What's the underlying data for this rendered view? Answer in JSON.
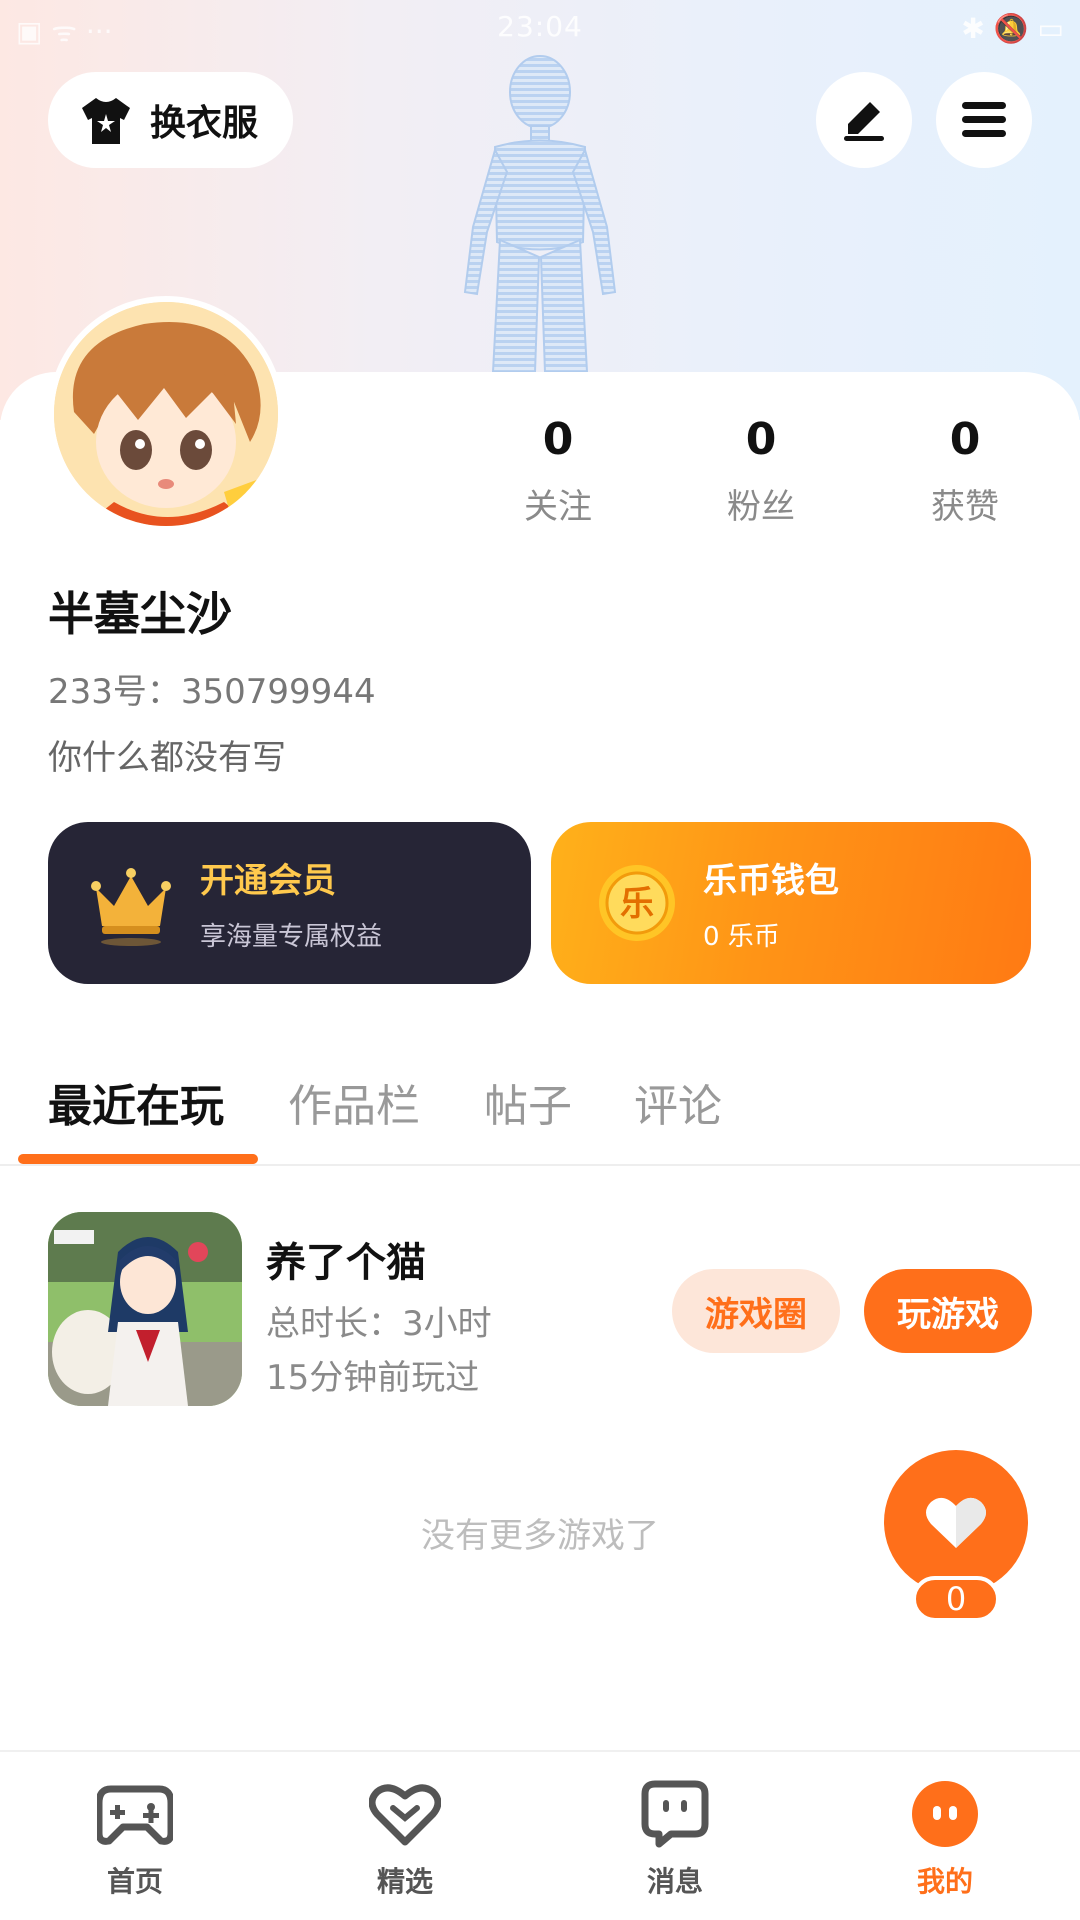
{
  "status_bar": {
    "time": "23:04",
    "left_icons": "▣  ᯤ  ···",
    "right_icons": "✱  🔕  ▭"
  },
  "header": {
    "change_clothes_label": "换衣服"
  },
  "profile": {
    "username": "半墓尘沙",
    "uid_label": "233号：350799944",
    "bio": "你什么都没有写",
    "stats": [
      {
        "value": "0",
        "label": "关注"
      },
      {
        "value": "0",
        "label": "粉丝"
      },
      {
        "value": "0",
        "label": "获赞"
      }
    ]
  },
  "promos": {
    "vip": {
      "title": "开通会员",
      "subtitle": "享海量专属权益"
    },
    "wallet": {
      "title": "乐币钱包",
      "subtitle": "0 乐币",
      "coin_char": "乐"
    }
  },
  "tabs": [
    "最近在玩",
    "作品栏",
    "帖子",
    "评论"
  ],
  "recent_game": {
    "name": "养了个猫",
    "total_time": "总时长：3小时",
    "last_played": "15分钟前玩过",
    "circle_button": "游戏圈",
    "play_button": "玩游戏"
  },
  "no_more_text": "没有更多游戏了",
  "favorite_count": "0",
  "bottom_nav": [
    {
      "label": "首页",
      "icon": "gamepad-icon"
    },
    {
      "label": "精选",
      "icon": "heart-chat-icon"
    },
    {
      "label": "消息",
      "icon": "message-bubble-icon"
    },
    {
      "label": "我的",
      "icon": "profile-face-icon"
    }
  ],
  "colors": {
    "accent": "#ff6f1a",
    "vip_bg": "#262536",
    "vip_title": "#ffc94d"
  }
}
